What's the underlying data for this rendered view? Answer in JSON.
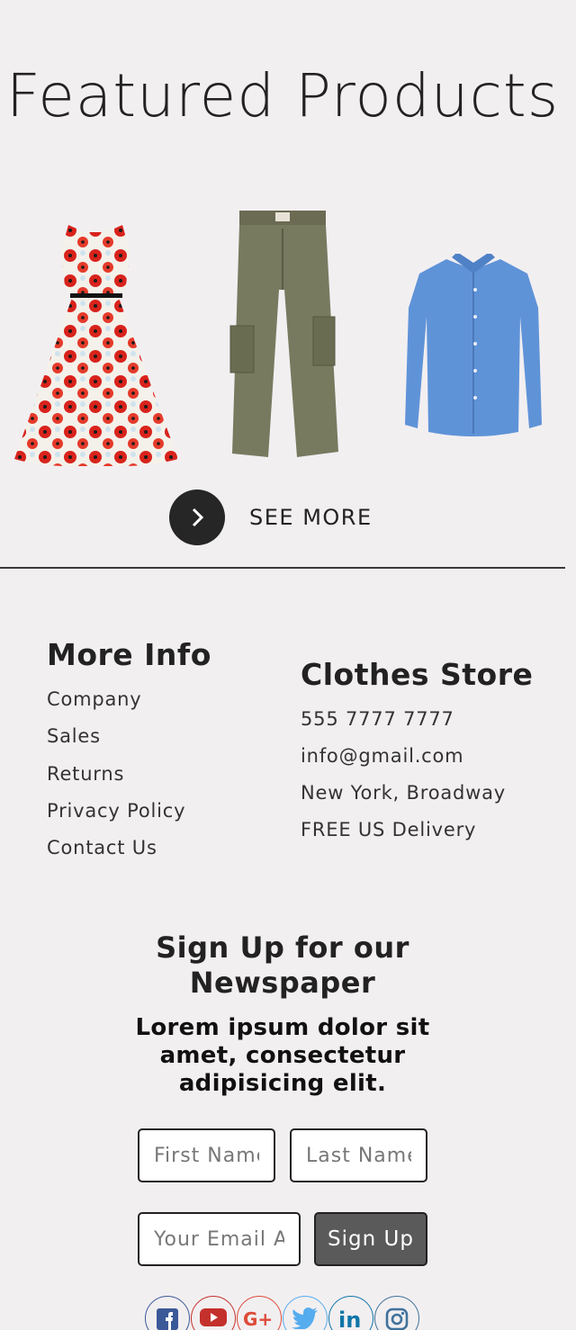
{
  "featured": {
    "title": "Featured Products",
    "products": [
      {
        "name": "poppy-dress"
      },
      {
        "name": "cargo-pants"
      },
      {
        "name": "blue-shirt"
      }
    ],
    "see_more_label": "SEE MORE"
  },
  "more_info": {
    "heading": "More Info",
    "links": [
      "Company",
      "Sales",
      "Returns",
      "Privacy Policy",
      "Contact Us"
    ]
  },
  "store": {
    "heading": "Clothes Store",
    "phone": "555 7777 7777",
    "email": "info@gmail.com",
    "address": "New York, Broadway",
    "delivery": "FREE US Delivery"
  },
  "signup": {
    "title": "Sign Up for our Newspaper",
    "text": "Lorem ipsum dolor sit amet, consectetur adipisicing elit.",
    "first_name_placeholder": "First Name",
    "last_name_placeholder": "Last Name",
    "email_placeholder": "Your Email Address",
    "button_label": "Sign Up"
  },
  "social": [
    {
      "icon": "facebook-icon",
      "color": "#3b5998"
    },
    {
      "icon": "youtube-icon",
      "color": "#c4302b"
    },
    {
      "icon": "google-plus-icon",
      "color": "#dd4b39"
    },
    {
      "icon": "twitter-icon",
      "color": "#55acee"
    },
    {
      "icon": "linkedin-icon",
      "color": "#0e76a8"
    },
    {
      "icon": "instagram-icon",
      "color": "#3f729b"
    }
  ]
}
